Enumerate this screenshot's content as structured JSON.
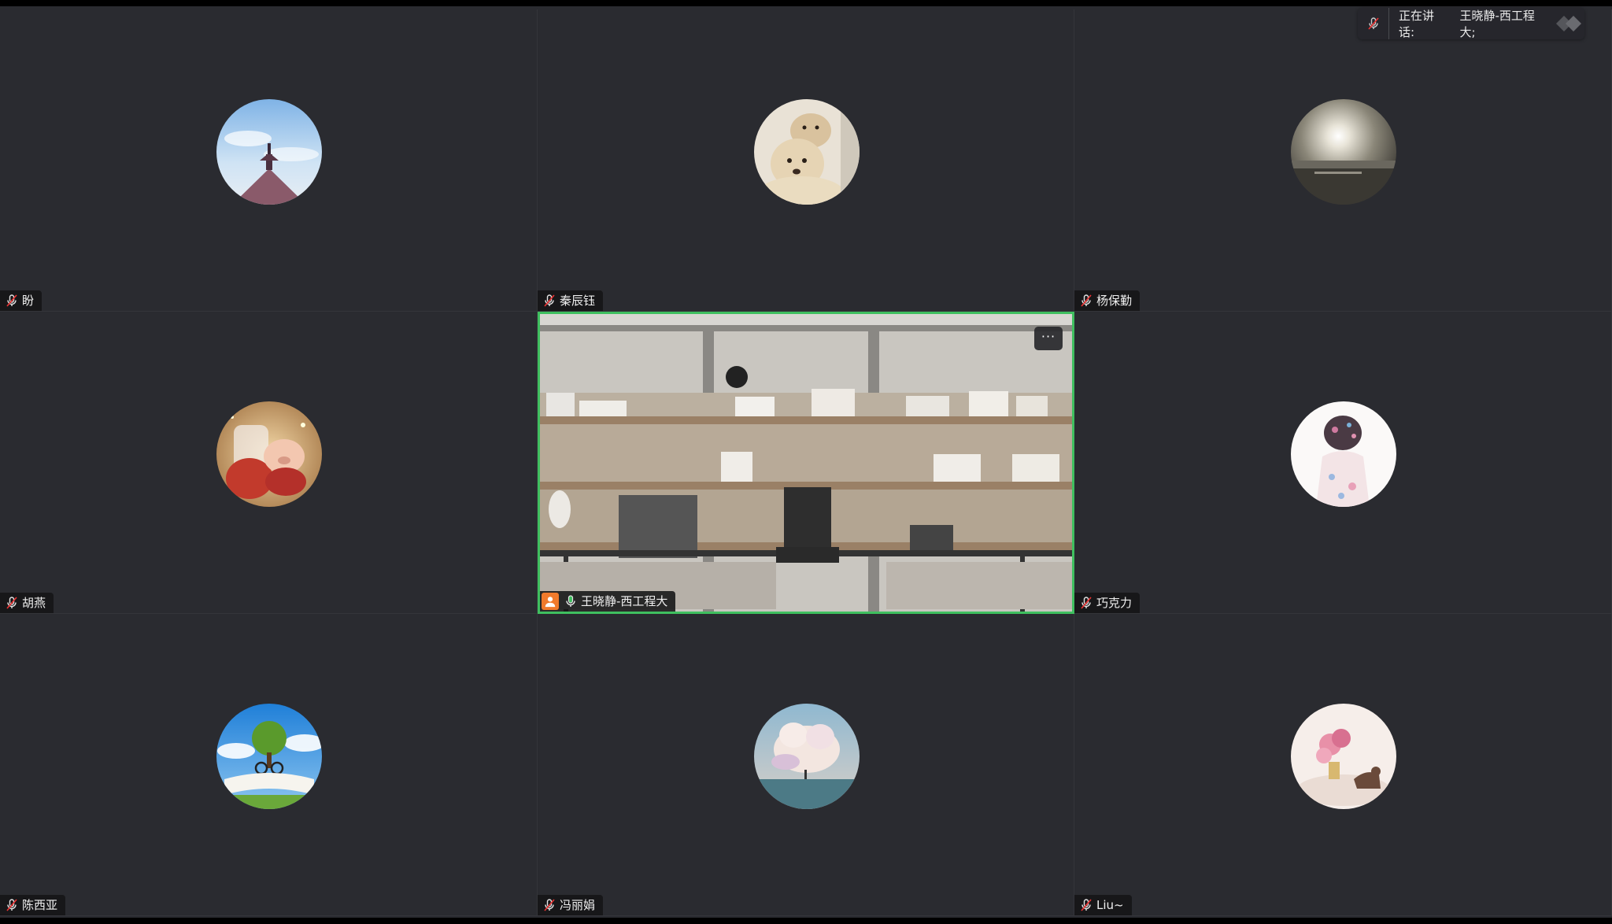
{
  "participants": [
    {
      "name": "盼",
      "avatar": "pagoda-sky-avatar"
    },
    {
      "name": "秦辰钰",
      "avatar": "dogs-avatar"
    },
    {
      "name": "杨保勤",
      "avatar": "sunset-lake-avatar"
    },
    {
      "name": "胡燕",
      "avatar": "piggy-avatar"
    },
    {
      "name": "王晓静-西工程大",
      "avatar": "office-bookshelf-video"
    },
    {
      "name": "巧克力",
      "avatar": "girl-back-avatar"
    },
    {
      "name": "陈西亚",
      "avatar": "tree-book-avatar"
    },
    {
      "name": "冯丽娟",
      "avatar": "cloud-sea-avatar"
    },
    {
      "name": "Liu~",
      "avatar": "flower-horse-avatar"
    }
  ],
  "active_speaker": {
    "label": "正在讲话:",
    "name": "王晓静-西工程大;"
  },
  "more_button": "···",
  "colors": {
    "active_border": "#3fbf5f",
    "host_badge": "#f07a2c",
    "tile_bg": "#2a2b30"
  }
}
